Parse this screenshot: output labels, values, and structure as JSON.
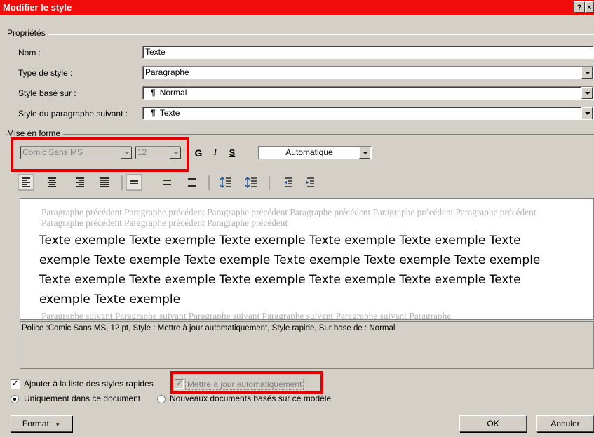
{
  "window": {
    "title": "Modifier le style",
    "help_label": "?",
    "close_label": "×"
  },
  "proprietes": {
    "group_label": "Propriétés",
    "nom_label": "Nom :",
    "nom_value": "Texte",
    "type_label": "Type de style :",
    "type_value": "Paragraphe",
    "base_label": "Style basé sur :",
    "base_value": "Normal",
    "suivant_label": "Style du paragraphe suivant :",
    "suivant_value": "Texte"
  },
  "mise_en_forme": {
    "group_label": "Mise en forme",
    "font_value": "Comic Sans MS",
    "size_value": "12",
    "bold_label": "G",
    "italic_label": "I",
    "underline_label": "S",
    "color_value": "Automatique"
  },
  "preview": {
    "previous": "Paragraphe précédent Paragraphe précédent Paragraphe précédent Paragraphe précédent Paragraphe précédent Paragraphe précédent Paragraphe précédent Paragraphe précédent Paragraphe précédent",
    "sample": "Texte exemple Texte exemple Texte exemple Texte exemple Texte exemple Texte exemple Texte exemple Texte exemple Texte exemple Texte exemple Texte exemple Texte exemple Texte exemple Texte exemple Texte exemple Texte exemple Texte exemple Texte exemple",
    "following": "Paragraphe suivant Paragraphe suivant Paragraphe suivant Paragraphe suivant Paragraphe suivant Paragraphe"
  },
  "description": "Police :Comic Sans MS, 12 pt, Style : Mettre à jour automatiquement, Style rapide, Sur base de : Normal",
  "options": {
    "quick_styles_label": "Ajouter à la liste des styles rapides",
    "auto_update_label": "Mettre à jour automatiquement",
    "this_doc_label": "Uniquement dans ce document",
    "new_docs_label": "Nouveaux documents basés sur ce modèle"
  },
  "buttons": {
    "format": "Format",
    "ok": "OK",
    "cancel": "Annuler"
  },
  "colors": {
    "titlebar": "#f20b0b",
    "highlight": "#e00000",
    "dialog_bg": "#d4d0c8"
  }
}
